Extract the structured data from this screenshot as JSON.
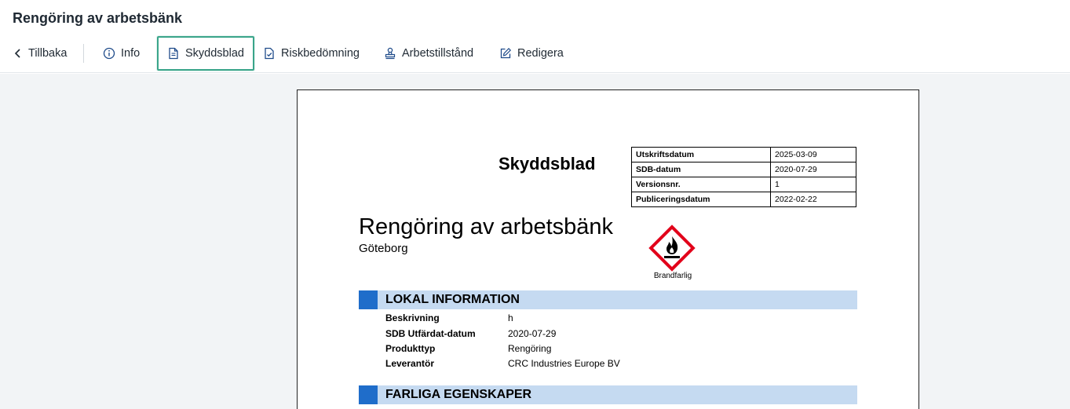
{
  "app": {
    "title": "Rengöring av arbetsbänk"
  },
  "toolbar": {
    "back": "Tillbaka",
    "info": "Info",
    "skyddsblad": "Skyddsblad",
    "riskbedomning": "Riskbedömning",
    "arbetstillstand": "Arbetstillstånd",
    "redigera": "Redigera"
  },
  "colors": {
    "active_outline": "#3aa58a",
    "section_bg": "#c5daf1",
    "section_block": "#1f6dca",
    "hazard_red": "#e2001a"
  },
  "doc": {
    "heading": "Skyddsblad",
    "meta": [
      {
        "key": "Utskriftsdatum",
        "value": "2025-03-09"
      },
      {
        "key": "SDB-datum",
        "value": "2020-07-29"
      },
      {
        "key": "Versionsnr.",
        "value": "1"
      },
      {
        "key": "Publiceringsdatum",
        "value": "2022-02-22"
      }
    ],
    "title": "Rengöring av arbetsbänk",
    "subtitle": "Göteborg",
    "hazard": {
      "icon": "flame-pictogram",
      "label": "Brandfarlig"
    },
    "sections": [
      {
        "title": "LOKAL INFORMATION",
        "rows": [
          {
            "key": "Beskrivning",
            "value": "h"
          },
          {
            "key": "SDB Utfärdat-datum",
            "value": "2020-07-29"
          },
          {
            "key": "Produkttyp",
            "value": "Rengöring"
          },
          {
            "key": "Leverantör",
            "value": "CRC Industries Europe BV"
          }
        ]
      },
      {
        "title": "FARLIGA EGENSKAPER"
      }
    ]
  }
}
